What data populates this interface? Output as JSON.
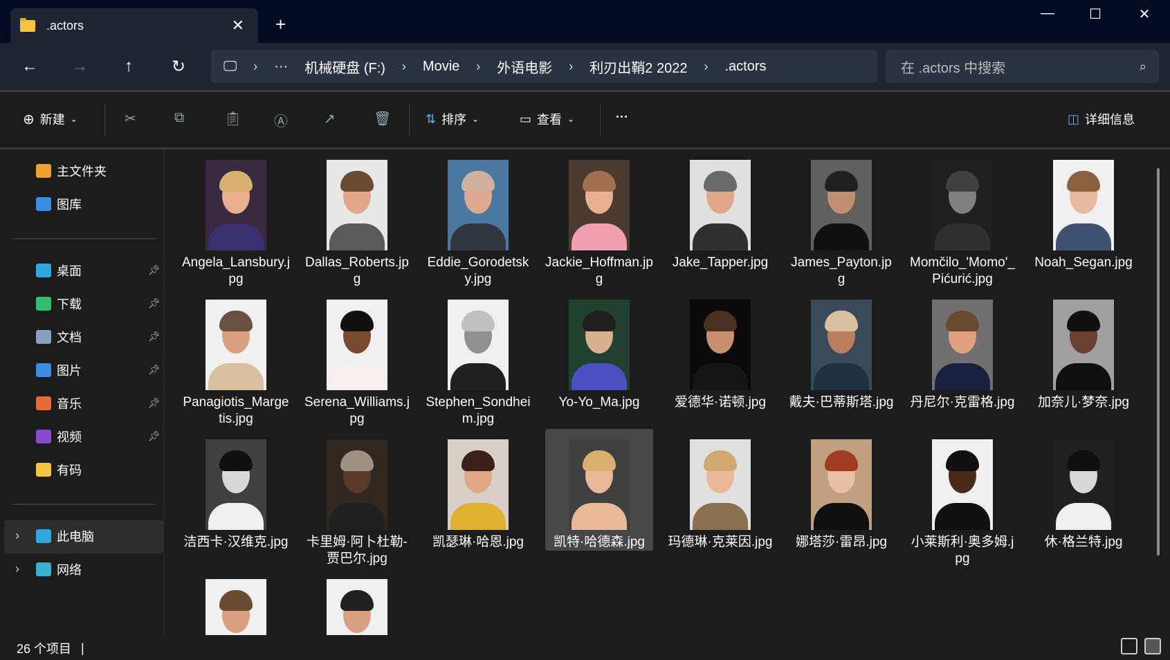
{
  "window": {
    "tab_title": ".actors",
    "new_tab": "+",
    "minimize": "—",
    "maximize": "☐",
    "close": "✕",
    "tab_close": "✕"
  },
  "nav": {
    "back": "←",
    "forward": "→",
    "up": "↑",
    "refresh": "↻"
  },
  "address": {
    "pc_icon": "🖵",
    "chev": "›",
    "more": "···",
    "crumbs": [
      "机械硬盘 (F:)",
      "Movie",
      "外语电影",
      "利刃出鞘2 2022",
      ".actors"
    ]
  },
  "search": {
    "placeholder": "在 .actors 中搜索",
    "icon": "⌕"
  },
  "toolbar": {
    "new": "新建",
    "sort": "排序",
    "view": "查看",
    "more": "···",
    "details": "详细信息"
  },
  "sidebar": {
    "items": [
      {
        "label": "主文件夹",
        "color": "#f0a030"
      },
      {
        "label": "图库",
        "color": "#3a8ee6"
      },
      {
        "label": "桌面",
        "color": "#2fa7e0",
        "pin": true
      },
      {
        "label": "下载",
        "color": "#2fc070",
        "pin": true
      },
      {
        "label": "文档",
        "color": "#8aa0c0",
        "pin": true
      },
      {
        "label": "图片",
        "color": "#3a8ee6",
        "pin": true
      },
      {
        "label": "音乐",
        "color": "#e56a3a",
        "pin": true
      },
      {
        "label": "视频",
        "color": "#8a4ad0",
        "pin": true
      },
      {
        "label": "有码",
        "color": "#f5c443"
      },
      {
        "label": "此电脑",
        "color": "#2fa7e0"
      },
      {
        "label": "网络",
        "color": "#3ab0d0"
      }
    ]
  },
  "files": [
    {
      "name": "Angela_Lansbury.jpg",
      "bg": "#3a2a40",
      "skin": "#e8b090",
      "hair": "#d8b070",
      "cloth": "#3a3070"
    },
    {
      "name": "Dallas_Roberts.jpg",
      "bg": "#e8e8e8",
      "skin": "#e0a888",
      "hair": "#6a4a30",
      "cloth": "#5a5a5a"
    },
    {
      "name": "Eddie_Gorodetsky.jpg",
      "bg": "#4a78a0",
      "skin": "#e0a890",
      "hair": "#d0b0a0",
      "cloth": "#303540"
    },
    {
      "name": "Jackie_Hoffman.jpg",
      "bg": "#4a3a30",
      "skin": "#e8b090",
      "hair": "#a07050",
      "cloth": "#f0a0b0"
    },
    {
      "name": "Jake_Tapper.jpg",
      "bg": "#e0e0e0",
      "skin": "#e0a888",
      "hair": "#6a6a6a",
      "cloth": "#303030"
    },
    {
      "name": "James_Payton.jpg",
      "bg": "#606060",
      "skin": "#c09070",
      "hair": "#202020",
      "cloth": "#101010"
    },
    {
      "name": "Momčilo_'Momo'_Pićurić.jpg",
      "bg": "#202020",
      "skin": "#808080",
      "hair": "#404040",
      "cloth": "#303030"
    },
    {
      "name": "Noah_Segan.jpg",
      "bg": "#f0f0f0",
      "skin": "#e8b8a0",
      "hair": "#8a6040",
      "cloth": "#405070"
    },
    {
      "name": "Panagiotis_Margetis.jpg",
      "bg": "#f0f0f0",
      "skin": "#d8a080",
      "hair": "#6a5040",
      "cloth": "#d8c0a0"
    },
    {
      "name": "Serena_Williams.jpg",
      "bg": "#f0f0f0",
      "skin": "#7a4a30",
      "hair": "#101010",
      "cloth": "#f8f0f0"
    },
    {
      "name": "Stephen_Sondheim.jpg",
      "bg": "#f0f0f0",
      "skin": "#909090",
      "hair": "#c0c0c0",
      "cloth": "#202020"
    },
    {
      "name": "Yo-Yo_Ma.jpg",
      "bg": "#204030",
      "skin": "#d8b090",
      "hair": "#202020",
      "cloth": "#4a50c0"
    },
    {
      "name": "爱德华·诺顿.jpg",
      "bg": "#0a0a0a",
      "skin": "#c89070",
      "hair": "#4a3020",
      "cloth": "#151515"
    },
    {
      "name": "戴夫·巴蒂斯塔.jpg",
      "bg": "#3a4a5a",
      "skin": "#b88060",
      "hair": "#d8c0a0",
      "cloth": "#203040"
    },
    {
      "name": "丹尼尔·克雷格.jpg",
      "bg": "#707070",
      "skin": "#e0a080",
      "hair": "#6a4a30",
      "cloth": "#1a2040"
    },
    {
      "name": "加奈儿·梦奈.jpg",
      "bg": "#a0a0a0",
      "skin": "#6a4030",
      "hair": "#101010",
      "cloth": "#101010"
    },
    {
      "name": "洁西卡·汉维克.jpg",
      "bg": "#404040",
      "skin": "#d8d8d8",
      "hair": "#101010",
      "cloth": "#f0f0f0"
    },
    {
      "name": "卡里姆·阿卜杜勒-贾巴尔.jpg",
      "bg": "#302820",
      "skin": "#5a3a28",
      "hair": "#a09080",
      "cloth": "#202020"
    },
    {
      "name": "凯瑟琳·哈恩.jpg",
      "bg": "#d8d0c8",
      "skin": "#e0a888",
      "hair": "#3a2018",
      "cloth": "#e0b030"
    },
    {
      "name": "凯特·哈德森.jpg",
      "bg": "#404040",
      "skin": "#e8b898",
      "hair": "#d8b070",
      "cloth": "#e8b898",
      "selected": true
    },
    {
      "name": "玛德琳·克莱因.jpg",
      "bg": "#e0e0e0",
      "skin": "#e8b898",
      "hair": "#d0a870",
      "cloth": "#8a7050"
    },
    {
      "name": "娜塔莎·雷昂.jpg",
      "bg": "#c0a080",
      "skin": "#e8c0a8",
      "hair": "#a03a20",
      "cloth": "#101010"
    },
    {
      "name": "小莱斯利·奥多姆.jpg",
      "bg": "#f0f0f0",
      "skin": "#4a2a1a",
      "hair": "#101010",
      "cloth": "#101010"
    },
    {
      "name": "休·格兰特.jpg",
      "bg": "#202020",
      "skin": "#d8d8d8",
      "hair": "#101010",
      "cloth": "#f0f0f0"
    },
    {
      "name": "",
      "bg": "#f0f0f0",
      "skin": "#d8a080",
      "hair": "#6a4a30",
      "cloth": "#303030"
    },
    {
      "name": "",
      "bg": "#f0f0f0",
      "skin": "#d8a080",
      "hair": "#202020",
      "cloth": "#303030"
    }
  ],
  "status": {
    "count": "26 个项目"
  }
}
